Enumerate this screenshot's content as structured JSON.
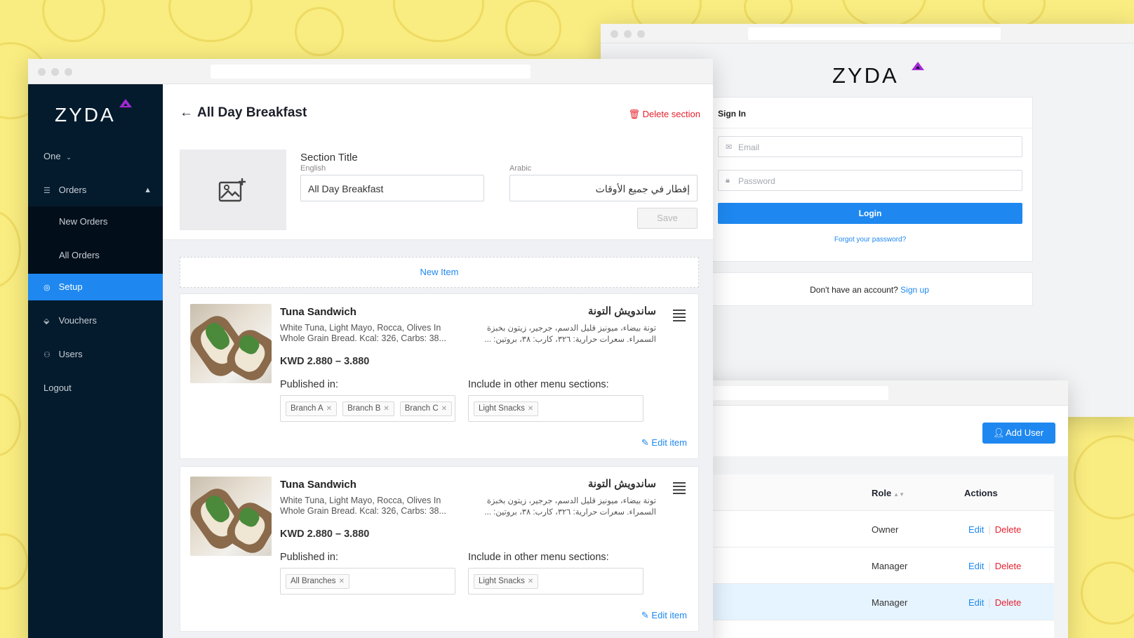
{
  "login": {
    "logo": "ZYDA",
    "card_title": "Sign In",
    "email_placeholder": "Email",
    "password_placeholder": "Password",
    "login_label": "Login",
    "forgot_label": "Forgot your password?",
    "no_account_text": "Don't have an account?",
    "signup_label": "Sign up"
  },
  "users": {
    "add_user_label": "Add User",
    "columns": {
      "role": "Role",
      "actions": "Actions"
    },
    "rows": [
      {
        "role": "Owner",
        "edit": "Edit",
        "delete": "Delete"
      },
      {
        "role": "Manager",
        "edit": "Edit",
        "delete": "Delete"
      },
      {
        "role": "Manager",
        "edit": "Edit",
        "delete": "Delete"
      }
    ]
  },
  "sidebar": {
    "logo": "ZYDA",
    "branch_selector": "One",
    "items": [
      {
        "label": "Orders",
        "icon": "list-icon"
      },
      {
        "label": "New Orders"
      },
      {
        "label": "All Orders"
      },
      {
        "label": "Setup",
        "icon": "gear-icon"
      },
      {
        "label": "Vouchers",
        "icon": "tag-icon"
      },
      {
        "label": "Users",
        "icon": "users-icon"
      },
      {
        "label": "Logout"
      }
    ]
  },
  "section": {
    "title": "All Day Breakfast",
    "delete_label": "Delete section",
    "section_title_label": "Section Title",
    "english_label": "English",
    "arabic_label": "Arabic",
    "english_value": "All Day Breakfast",
    "arabic_value": "إفطار في جميع الأوقات",
    "save_label": "Save",
    "new_item_label": "New Item"
  },
  "items": [
    {
      "name": "Tuna Sandwich",
      "name_ar": "ساندويش التونة",
      "description": "White Tuna, Light Mayo, Rocca, Olives In Whole Grain Bread. Kcal: 326, Carbs: 38...",
      "description_ar": "تونة بيضاء، ميونيز قليل الدسم، جرجير، زيتون بخبزة السمراء. سعرات حرارية: ٣٢٦، كارب: ٣٨، بروتين: ...",
      "price": "KWD 2.880 – 3.880",
      "published_label": "Published in:",
      "include_label": "Include in other menu sections:",
      "published": [
        "Branch A",
        "Branch B",
        "Branch C"
      ],
      "sections": [
        "Light Snacks"
      ],
      "edit_label": "Edit item"
    },
    {
      "name": "Tuna Sandwich",
      "name_ar": "ساندويش التونة",
      "description": "White Tuna, Light Mayo, Rocca, Olives In Whole Grain Bread. Kcal: 326, Carbs: 38...",
      "description_ar": "تونة بيضاء، ميونيز قليل الدسم، جرجير، زيتون بخبزة السمراء. سعرات حرارية: ٣٢٦، كارب: ٣٨، بروتين: ...",
      "price": "KWD 2.880 – 3.880",
      "published_label": "Published in:",
      "include_label": "Include in other menu sections:",
      "published": [
        "All Branches"
      ],
      "sections": [
        "Light Snacks"
      ],
      "edit_label": "Edit item"
    }
  ],
  "colors": {
    "background": "#f9ec80",
    "accent": "#1e88f0",
    "sidebar": "#041b2d",
    "danger": "#e5202e",
    "brand_purple": "#a528d7"
  }
}
